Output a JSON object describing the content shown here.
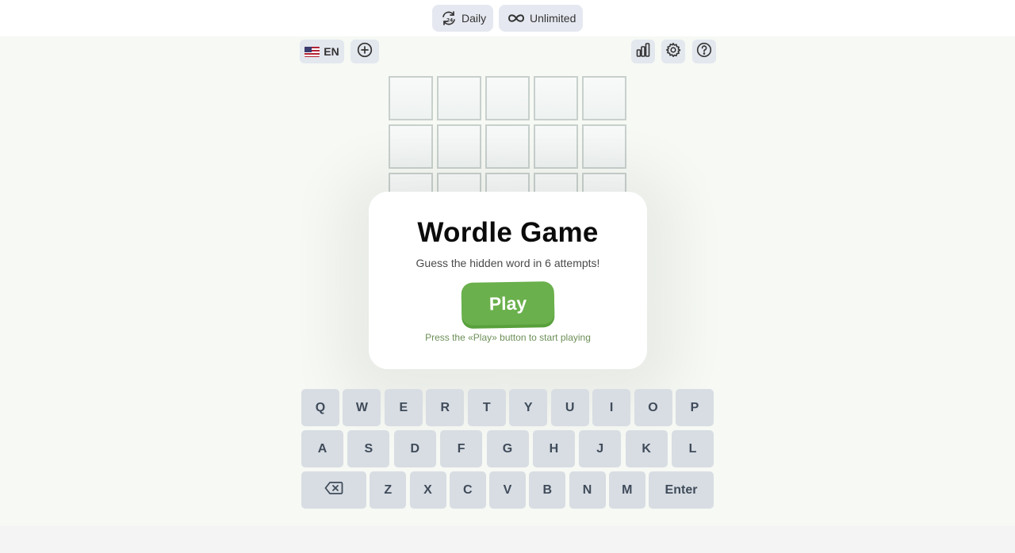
{
  "modes": {
    "daily": {
      "label": "Daily",
      "icon": "refresh-24-icon"
    },
    "unlimited": {
      "label": "Unlimited",
      "icon": "infinity-icon"
    }
  },
  "toolbar": {
    "language": {
      "code": "EN",
      "flag": "us-flag-icon"
    },
    "icons": [
      "plus-circle-icon",
      "bar-chart-icon",
      "gear-icon",
      "help-circle-icon"
    ]
  },
  "board": {
    "rows_visible": 3,
    "columns": 5
  },
  "modal": {
    "title": "Wordle Game",
    "subtitle": "Guess the hidden word in 6 attempts!",
    "play_label": "Play",
    "hint": "Press the «Play» button to start playing"
  },
  "keyboard": {
    "row1": [
      "Q",
      "W",
      "E",
      "R",
      "T",
      "Y",
      "U",
      "I",
      "O",
      "P"
    ],
    "row2": [
      "A",
      "S",
      "D",
      "F",
      "G",
      "H",
      "J",
      "K",
      "L"
    ],
    "row3": [
      "Z",
      "X",
      "C",
      "V",
      "B",
      "N",
      "M"
    ],
    "enter_label": "Enter",
    "backspace_icon": "backspace-icon"
  },
  "colors": {
    "accent_green": "#6ab04c",
    "key_bg": "#d8dde3",
    "board_bg": "#f6f9f4"
  }
}
